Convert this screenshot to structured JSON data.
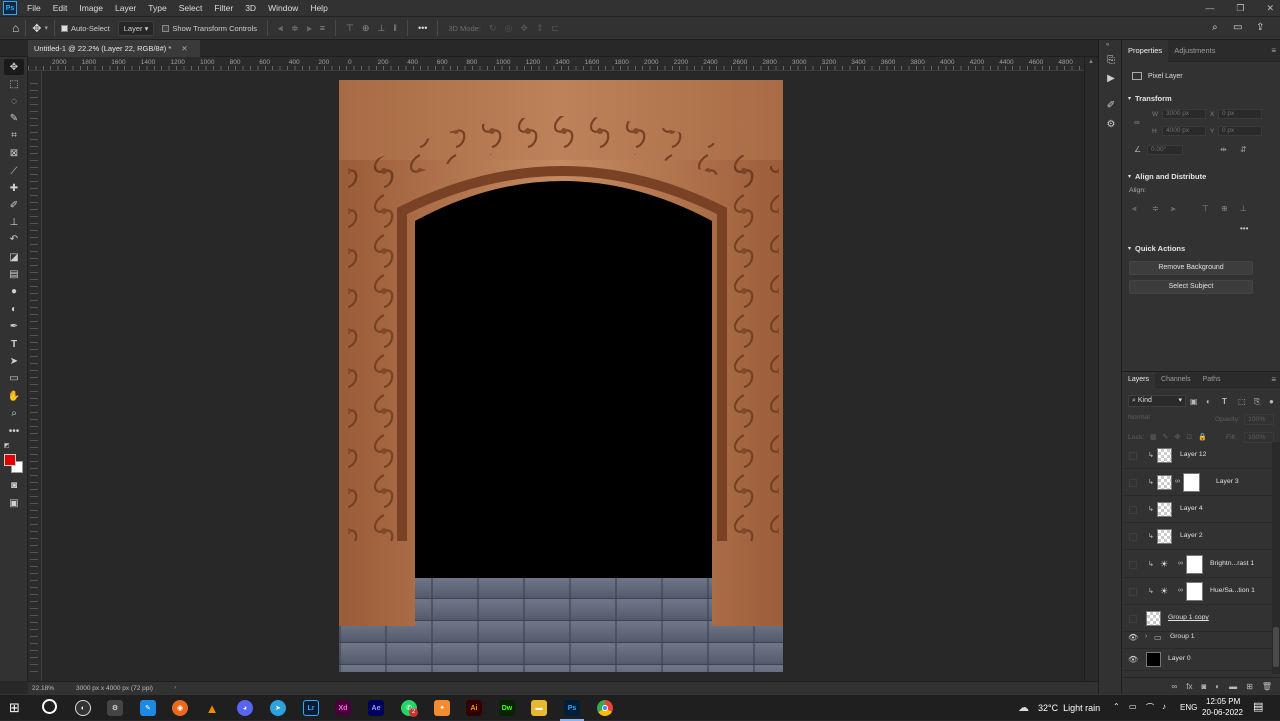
{
  "app": {
    "logo": "Ps"
  },
  "menu": [
    "File",
    "Edit",
    "Image",
    "Layer",
    "Type",
    "Select",
    "Filter",
    "3D",
    "Window",
    "Help"
  ],
  "options": {
    "auto_select": "Auto-Select",
    "target": "Layer",
    "show_transform": "Show Transform Controls",
    "mode_3d": "3D Mode:"
  },
  "document": {
    "tab_title": "Untitled-1 @ 22.2% (Layer 22, RGB/8#) *"
  },
  "ruler": {
    "top": [
      "2000",
      "1800",
      "1600",
      "1400",
      "1200",
      "1000",
      "800",
      "600",
      "400",
      "200",
      "0",
      "200",
      "400",
      "600",
      "800",
      "1000",
      "1200",
      "1400",
      "1600",
      "1800",
      "2000",
      "2200",
      "2400",
      "2600",
      "2800",
      "3000",
      "3200",
      "3400",
      "3600",
      "3800",
      "4000",
      "4200",
      "4400",
      "4600",
      "4800"
    ]
  },
  "status": {
    "zoom": "22.18%",
    "doc_size": "3000 px x 4000 px (72 ppi)"
  },
  "properties": {
    "tabs": [
      "Properties",
      "Adjustments"
    ],
    "kind": "Pixel Layer",
    "transform": {
      "title": "Transform",
      "w": "3000 px",
      "h": "4000 px",
      "x": "0 px",
      "y": "0 px",
      "w_label": "W",
      "h_label": "H",
      "x_label": "X",
      "y_label": "Y",
      "angle": "0.00°"
    },
    "align": {
      "title": "Align and Distribute",
      "label": "Align:"
    },
    "quick": {
      "title": "Quick Actions",
      "remove_bg": "Remove Background",
      "select_subject": "Select Subject"
    }
  },
  "layers_panel": {
    "tabs": [
      "Layers",
      "Channels",
      "Paths"
    ],
    "kind": "Kind",
    "blend": "Normal",
    "opacity_label": "Opacity:",
    "opacity": "100%",
    "lock_label": "Lock:",
    "fill_label": "Fill:",
    "fill": "100%",
    "layers": [
      {
        "name": "Layer 12",
        "clip": true,
        "visible": false,
        "mask": false,
        "thumb": "checker"
      },
      {
        "name": "Layer 3",
        "clip": true,
        "visible": false,
        "mask": true,
        "thumb": "checker"
      },
      {
        "name": "Layer 4",
        "clip": true,
        "visible": false,
        "mask": false,
        "thumb": "checker"
      },
      {
        "name": "Layer 2",
        "clip": true,
        "visible": false,
        "mask": false,
        "thumb": "checker"
      },
      {
        "name": "Brightn...rast 1",
        "clip": true,
        "visible": false,
        "mask": true,
        "thumb": "adjust"
      },
      {
        "name": "Hue/Sa...tion 1",
        "clip": true,
        "visible": false,
        "mask": true,
        "thumb": "adjust"
      },
      {
        "name": "Group 1 copy",
        "clip": false,
        "visible": false,
        "mask": false,
        "thumb": "checker"
      },
      {
        "name": "Group 1",
        "clip": false,
        "visible": true,
        "mask": false,
        "thumb": "folder"
      },
      {
        "name": "Layer 0",
        "clip": false,
        "visible": true,
        "mask": false,
        "thumb": "black"
      }
    ]
  },
  "taskbar": {
    "weather": "32°C  Light rain",
    "lang": "ENG",
    "time": "12:05 PM",
    "date": "20-06-2022",
    "notif_count": "2",
    "apps": [
      "Lr",
      "Xd",
      "Ae",
      "Ai",
      "Dw",
      "Ps"
    ]
  },
  "colors": {
    "foreground": "#e00000",
    "background": "#ffffff",
    "ps_blue": "#31a8ff"
  }
}
